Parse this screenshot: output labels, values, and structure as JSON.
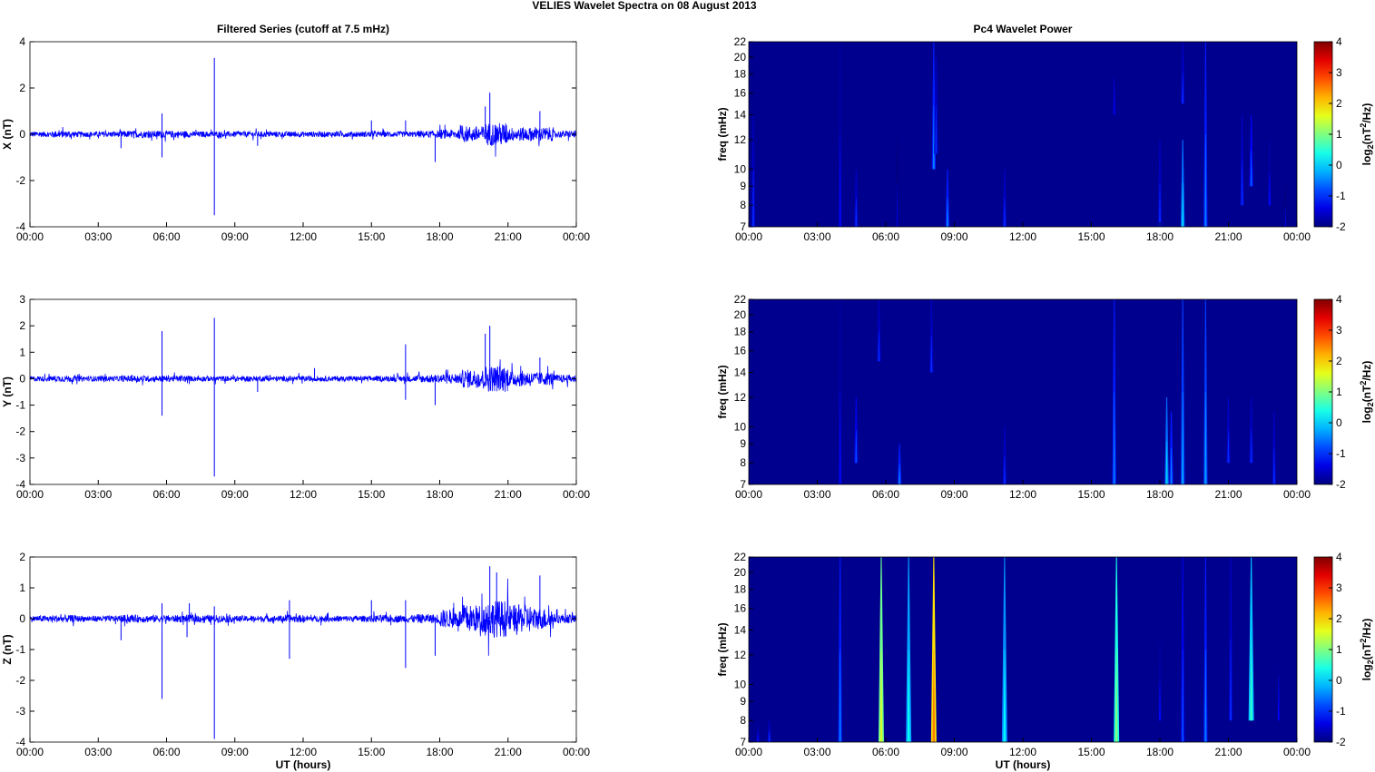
{
  "title": "VELIES Wavelet Spectra on 08 August    2013",
  "colors": {
    "series": "#0000ff",
    "background": "#00008f"
  },
  "chart_data": [
    {
      "type": "line",
      "title": "Filtered Series (cutoff at 7.5 mHz)",
      "xlabel": "",
      "ylabel": "X (nT)",
      "ylim": [
        -4,
        4
      ],
      "yticks": [
        -4,
        -2,
        0,
        2,
        4
      ],
      "xticks": [
        "00:00",
        "03:00",
        "06:00",
        "09:00",
        "12:00",
        "15:00",
        "18:00",
        "21:00",
        "00:00"
      ],
      "xlim_hours": [
        0,
        24
      ],
      "noise_envelope_hourly": [
        0.12,
        0.15,
        0.12,
        0.12,
        0.15,
        0.15,
        0.15,
        0.12,
        0.12,
        0.12,
        0.12,
        0.12,
        0.12,
        0.12,
        0.12,
        0.12,
        0.12,
        0.15,
        0.2,
        0.35,
        0.5,
        0.3,
        0.3,
        0.15
      ],
      "spikes": [
        [
          4.0,
          -0.6
        ],
        [
          5.8,
          0.9
        ],
        [
          5.8,
          -1.0
        ],
        [
          8.1,
          3.3
        ],
        [
          8.1,
          -3.5
        ],
        [
          10.0,
          -0.5
        ],
        [
          15.0,
          0.6
        ],
        [
          16.5,
          0.6
        ],
        [
          17.8,
          -1.2
        ],
        [
          20.0,
          1.2
        ],
        [
          20.2,
          1.8
        ],
        [
          22.4,
          1.0
        ]
      ]
    },
    {
      "type": "line",
      "title": "",
      "xlabel": "",
      "ylabel": "Y (nT)",
      "ylim": [
        -4,
        3
      ],
      "yticks": [
        -4,
        -3,
        -2,
        -1,
        0,
        1,
        2,
        3
      ],
      "xticks": [
        "00:00",
        "03:00",
        "06:00",
        "09:00",
        "12:00",
        "15:00",
        "18:00",
        "21:00",
        "00:00"
      ],
      "xlim_hours": [
        0,
        24
      ],
      "noise_envelope_hourly": [
        0.1,
        0.12,
        0.1,
        0.1,
        0.12,
        0.12,
        0.12,
        0.1,
        0.1,
        0.1,
        0.1,
        0.1,
        0.1,
        0.1,
        0.1,
        0.1,
        0.12,
        0.15,
        0.2,
        0.35,
        0.5,
        0.3,
        0.25,
        0.15
      ],
      "spikes": [
        [
          5.8,
          1.8
        ],
        [
          5.8,
          -1.4
        ],
        [
          8.1,
          2.3
        ],
        [
          8.1,
          -3.7
        ],
        [
          10.0,
          -0.5
        ],
        [
          12.5,
          0.4
        ],
        [
          16.5,
          1.3
        ],
        [
          16.5,
          -0.8
        ],
        [
          17.8,
          -1.0
        ],
        [
          20.0,
          1.7
        ],
        [
          20.2,
          2.0
        ],
        [
          22.4,
          0.8
        ]
      ]
    },
    {
      "type": "line",
      "title": "",
      "xlabel": "UT (hours)",
      "ylabel": "Z (nT)",
      "ylim": [
        -4,
        2
      ],
      "yticks": [
        -4,
        -3,
        -2,
        -1,
        0,
        1,
        2
      ],
      "xticks": [
        "00:00",
        "03:00",
        "06:00",
        "09:00",
        "12:00",
        "15:00",
        "18:00",
        "21:00",
        "00:00"
      ],
      "xlim_hours": [
        0,
        24
      ],
      "noise_envelope_hourly": [
        0.1,
        0.12,
        0.1,
        0.1,
        0.12,
        0.12,
        0.12,
        0.12,
        0.12,
        0.1,
        0.1,
        0.12,
        0.1,
        0.1,
        0.1,
        0.12,
        0.12,
        0.15,
        0.3,
        0.45,
        0.6,
        0.45,
        0.35,
        0.15
      ],
      "spikes": [
        [
          4.0,
          -0.7
        ],
        [
          5.8,
          -2.6
        ],
        [
          5.8,
          0.5
        ],
        [
          6.9,
          -0.6
        ],
        [
          7.0,
          0.5
        ],
        [
          8.1,
          -3.9
        ],
        [
          8.1,
          0.4
        ],
        [
          11.4,
          -1.3
        ],
        [
          11.4,
          0.6
        ],
        [
          15.0,
          0.6
        ],
        [
          16.5,
          -1.6
        ],
        [
          16.5,
          0.6
        ],
        [
          17.8,
          -1.2
        ],
        [
          20.2,
          1.7
        ],
        [
          20.5,
          1.5
        ],
        [
          22.4,
          1.4
        ]
      ]
    },
    {
      "type": "heatmap",
      "title": "Pc4 Wavelet Power",
      "xlabel": "",
      "ylabel": "freq (mHz)",
      "colorbar_label": "log2(nT2/Hz)",
      "clim": [
        -2,
        4
      ],
      "cticks": [
        -2,
        -1,
        0,
        1,
        2,
        3,
        4
      ],
      "yticks": [
        7,
        8,
        9,
        10,
        12,
        14,
        16,
        18,
        20,
        22
      ],
      "xticks": [
        "00:00",
        "03:00",
        "06:00",
        "09:00",
        "12:00",
        "15:00",
        "18:00",
        "21:00",
        "00:00"
      ],
      "streaks": [
        [
          0.2,
          7,
          14,
          -1
        ],
        [
          4.0,
          7,
          22,
          -1.2
        ],
        [
          4.7,
          7,
          10,
          -1
        ],
        [
          6.5,
          7,
          12,
          -1.5
        ],
        [
          8.1,
          10,
          22,
          -0.5
        ],
        [
          8.2,
          11,
          20,
          -1
        ],
        [
          8.7,
          7,
          10,
          -0.5
        ],
        [
          11.2,
          7,
          10,
          -1
        ],
        [
          16.0,
          14,
          22,
          -1.3
        ],
        [
          18.0,
          7,
          12,
          -1
        ],
        [
          19.0,
          7,
          12,
          0
        ],
        [
          19.0,
          15,
          22,
          -1
        ],
        [
          20.0,
          7,
          22,
          -0.5
        ],
        [
          21.6,
          8,
          14,
          -1
        ],
        [
          22.0,
          9,
          14,
          -0.7
        ],
        [
          22.8,
          8,
          12,
          -1.2
        ],
        [
          23.5,
          7,
          9,
          -1.5
        ]
      ]
    },
    {
      "type": "heatmap",
      "title": "",
      "xlabel": "",
      "ylabel": "freq (mHz)",
      "colorbar_label": "log2(nT2/Hz)",
      "clim": [
        -2,
        4
      ],
      "cticks": [
        -2,
        -1,
        0,
        1,
        2,
        3,
        4
      ],
      "yticks": [
        7,
        8,
        9,
        10,
        12,
        14,
        16,
        18,
        20,
        22
      ],
      "xticks": [
        "00:00",
        "03:00",
        "06:00",
        "09:00",
        "12:00",
        "15:00",
        "18:00",
        "21:00",
        "00:00"
      ],
      "streaks": [
        [
          4.0,
          7,
          22,
          -1.2
        ],
        [
          4.7,
          8,
          12,
          -0.8
        ],
        [
          5.7,
          15,
          22,
          -1
        ],
        [
          6.6,
          7,
          9,
          -0.5
        ],
        [
          8.0,
          14,
          22,
          -1
        ],
        [
          11.2,
          7,
          10,
          -1
        ],
        [
          16.0,
          7,
          22,
          -0.5
        ],
        [
          18.3,
          7,
          12,
          0
        ],
        [
          18.5,
          7,
          11,
          -0.5
        ],
        [
          19.0,
          7,
          22,
          -0.3
        ],
        [
          20.0,
          7,
          22,
          -0.3
        ],
        [
          21.0,
          8,
          12,
          -1
        ],
        [
          22.0,
          8,
          12,
          -1
        ],
        [
          23.0,
          7,
          11,
          -1
        ]
      ]
    },
    {
      "type": "heatmap",
      "title": "",
      "xlabel": "UT (hours)",
      "ylabel": "freq (mHz)",
      "colorbar_label": "log2(nT2/Hz)",
      "clim": [
        -2,
        4
      ],
      "cticks": [
        -2,
        -1,
        0,
        1,
        2,
        3,
        4
      ],
      "yticks": [
        7,
        8,
        9,
        10,
        12,
        14,
        16,
        18,
        20,
        22
      ],
      "xticks": [
        "00:00",
        "03:00",
        "06:00",
        "09:00",
        "12:00",
        "15:00",
        "18:00",
        "21:00",
        "00:00"
      ],
      "streaks": [
        [
          0.4,
          7,
          8,
          -1.2
        ],
        [
          0.9,
          7,
          8,
          -1
        ],
        [
          4.0,
          7,
          22,
          -0.5
        ],
        [
          5.8,
          7,
          22,
          1.5
        ],
        [
          7.0,
          7,
          22,
          0.3
        ],
        [
          8.1,
          7,
          22,
          2.5
        ],
        [
          11.2,
          7,
          22,
          0.2
        ],
        [
          16.1,
          7,
          22,
          1.0
        ],
        [
          18.0,
          8,
          13,
          -1.2
        ],
        [
          19.0,
          7,
          22,
          -0.8
        ],
        [
          20.0,
          7,
          22,
          -0.5
        ],
        [
          21.1,
          8,
          22,
          -1
        ],
        [
          22.0,
          8,
          22,
          0.5
        ],
        [
          23.2,
          8,
          14,
          -1.3
        ]
      ]
    }
  ]
}
